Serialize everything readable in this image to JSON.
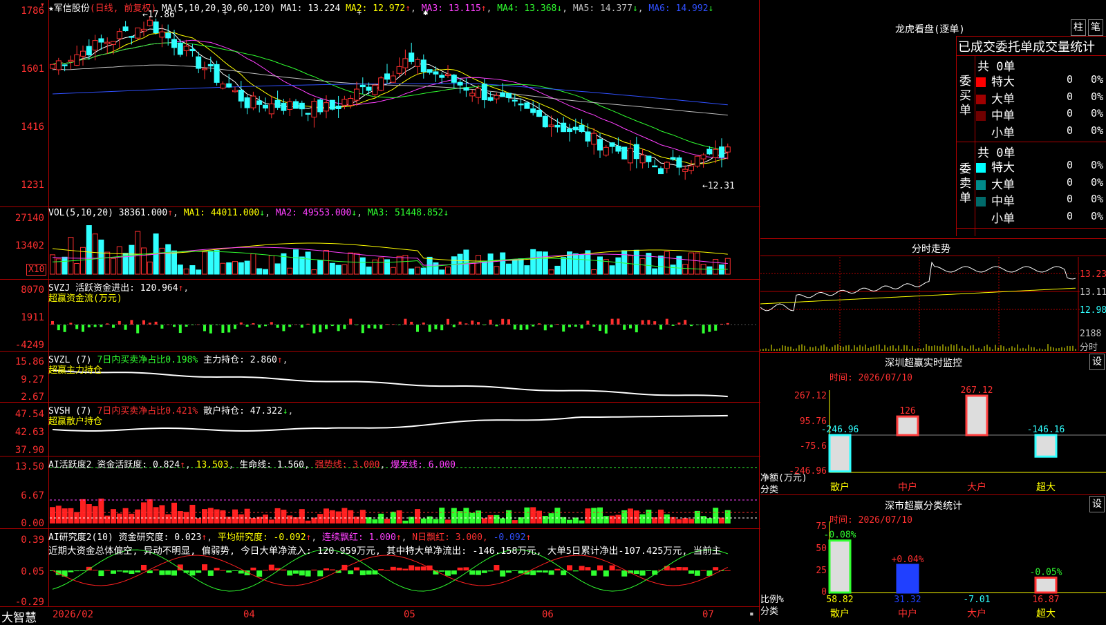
{
  "stock": {
    "star": "★",
    "name": "军信股份",
    "period": "(日线, 前复权)",
    "ma_params": "MA(5,10,20,30,60,120)",
    "ma1": "MA1: 13.224",
    "ma2": "MA2: 12.972",
    "ma3": "MA3: 13.115",
    "ma4": "MA4: 13.368",
    "ma5": "MA5: 14.377",
    "ma6": "MA6: 14.992",
    "high_mark": "17.86",
    "low_mark": "12.31"
  },
  "price_axis": [
    "1786",
    "1601",
    "1416",
    "1231"
  ],
  "vol": {
    "name": "VOL(5,10,20)",
    "value": "38361.000",
    "ma1": "MA1: 44011.000",
    "ma2": "MA2: 49553.000",
    "ma3": "MA3: 51448.852",
    "axis": [
      "27140",
      "13402"
    ],
    "unit": "X10"
  },
  "svzj": {
    "name": "SVZJ",
    "label": "活跃资金进出: 120.964",
    "sub": "超赢资金流(万元)",
    "axis": [
      "8070",
      "1911",
      "-4249"
    ]
  },
  "svzl": {
    "name": "SVZL (7)",
    "label": "7日内买卖净占比0.198%",
    "label2": "主力持仓: 2.860",
    "sub": "超赢主力持仓",
    "axis": [
      "15.86",
      "9.27",
      "2.67"
    ]
  },
  "svsh": {
    "name": "SVSH (7)",
    "label": "7日内买卖净占比0.421%",
    "label2": "散户持仓: 47.322",
    "sub": "超赢散户持仓",
    "axis": [
      "47.54",
      "42.63",
      "37.90"
    ]
  },
  "ai1": {
    "name": "AI活跃度2",
    "label": "资金活跃度: 0.824",
    "v2": "13.503",
    "v3": "生命线: 1.560",
    "v4": "强势线: 3.000",
    "v5": "爆发线: 6.000",
    "axis": [
      "13.50",
      "6.67",
      "0.00"
    ]
  },
  "ai2": {
    "name": "AI研究度2(10)",
    "label": "资金研究度: 0.023",
    "v2": "平均研究度: -0.092",
    "v3": "连续飘红: 1.000",
    "v4": "N日飘红: 3.000,",
    "v5": "-0.092",
    "comment": "近期大资金总体偏空, 异动不明显, 偏弱势, 今日大单净流入: 120.959万元, 其中特大单净流出: -146.158万元, 大单5日累计净出-107.425万元, 当前主",
    "axis": [
      "0.39",
      "0.05",
      "-0.29"
    ]
  },
  "bottom": {
    "logo": "大智慧",
    "dates": [
      "2026/02",
      "04",
      "05",
      "06",
      "07"
    ]
  },
  "longhu": {
    "title": "龙虎看盘(逐单)",
    "btn1": "柱",
    "btn2": "笔",
    "subtitle": "已成交委托单成交量统计",
    "buy_label": "委买单",
    "sell_label": "委卖单",
    "buy_total": "共 0单",
    "sell_total": "共 0单",
    "buy_rows": [
      {
        "name": "特大",
        "n": "0",
        "p": "0%",
        "color": "#ff0000"
      },
      {
        "name": "大单",
        "n": "0",
        "p": "0%",
        "color": "#a00000"
      },
      {
        "name": "中单",
        "n": "0",
        "p": "0%",
        "color": "#700000"
      },
      {
        "name": "小单",
        "n": "0",
        "p": "0%",
        "color": ""
      }
    ],
    "sell_rows": [
      {
        "name": "特大",
        "n": "0",
        "p": "0%",
        "color": "#00ffff"
      },
      {
        "name": "大单",
        "n": "0",
        "p": "0%",
        "color": "#008a8a"
      },
      {
        "name": "中单",
        "n": "0",
        "p": "0%",
        "color": "#006a6a"
      },
      {
        "name": "小单",
        "n": "0",
        "p": "0%",
        "color": ""
      }
    ]
  },
  "fenshi": {
    "title": "分时走势",
    "axis": [
      "13.23",
      "13.11",
      "12.98",
      "2188"
    ],
    "unit": "分时"
  },
  "monitor": {
    "title": "深圳超赢实时监控",
    "btn": "设",
    "time": "时间: 2026/07/10",
    "axis": [
      "267.12",
      "95.76",
      "-75.6",
      "-246.96"
    ],
    "ylabel": "净额(万元)",
    "xlabel": "分类",
    "cats": [
      "散户",
      "中户",
      "大户",
      "超大"
    ],
    "vals": [
      "-246.96",
      "126",
      "267.12",
      "-146.16"
    ]
  },
  "classify": {
    "title": "深市超赢分类统计",
    "btn": "设",
    "time": "时间: 2026/07/10",
    "axis": [
      "75",
      "50",
      "25",
      "0"
    ],
    "ylabel": "比例%",
    "xlabel": "分类",
    "cats": [
      "散户",
      "中户",
      "大户",
      "超大"
    ],
    "top": [
      "-0.08%",
      "+0.04%",
      "",
      "-0.05%"
    ],
    "bot": [
      "58.82",
      "31.32",
      "-7.01",
      "16.87"
    ]
  },
  "colors": {
    "up": "#ff3030",
    "down": "#30ffff",
    "bg": "#000000",
    "grid": "#b00000"
  }
}
